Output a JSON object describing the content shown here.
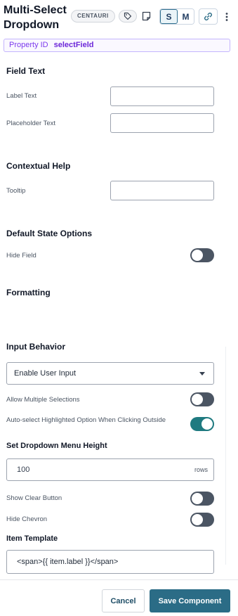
{
  "header": {
    "title": "Multi-Select Dropdown",
    "badge": "CENTAURI",
    "size_options": [
      "S",
      "M"
    ],
    "active_size": "S",
    "icons": [
      "tag-icon",
      "note-icon",
      "link-icon",
      "more-vertical-icon"
    ]
  },
  "property_id": {
    "label": "Property ID",
    "value": "selectField"
  },
  "field_text": {
    "section": "Field Text",
    "label_text_label": "Label Text",
    "label_text_value": "",
    "placeholder_text_label": "Placeholder Text",
    "placeholder_text_value": ""
  },
  "contextual_help": {
    "section": "Contextual Help",
    "tooltip_label": "Tooltip",
    "tooltip_value": ""
  },
  "default_state": {
    "section": "Default State Options",
    "hide_field_label": "Hide Field",
    "hide_field_on": false
  },
  "formatting": {
    "section": "Formatting"
  },
  "input_behavior": {
    "section": "Input Behavior",
    "input_mode_selected": "Enable User Input",
    "allow_multiple_label": "Allow Multiple Selections",
    "allow_multiple_on": false,
    "auto_select_label": "Auto-select Highlighted Option When Clicking Outside",
    "auto_select_on": true,
    "menu_height_label": "Set Dropdown Menu Height",
    "menu_height_value": "100",
    "menu_height_unit": "rows",
    "show_clear_label": "Show Clear Button",
    "show_clear_on": false,
    "hide_chevron_label": "Hide Chevron",
    "hide_chevron_on": false,
    "item_template_label": "Item Template",
    "item_template_value": "<span>{{ item.label }}</span>"
  },
  "footer": {
    "cancel_label": "Cancel",
    "save_label": "Save Component"
  },
  "colors": {
    "accent": "#2b6c86",
    "toggle_on": "#1f7a80",
    "toggle_off": "#4b5563",
    "property_border": "#c4b5fd"
  }
}
